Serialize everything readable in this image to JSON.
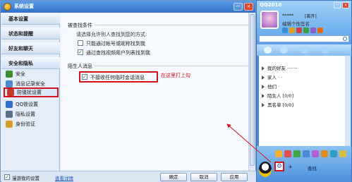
{
  "settings_window": {
    "title": "系统设置",
    "buttons": {
      "minimize": "－",
      "close": "×"
    },
    "sidebar": {
      "sections": [
        "基本设置",
        "状态和提醒",
        "好友和聊天",
        "安全和隐私"
      ],
      "items": [
        "安全",
        "消息记录安全",
        "防骚扰设置",
        "QQ锁设置",
        "隐私设置",
        "身份验证"
      ]
    },
    "content": {
      "section1_title": "被查找条件",
      "section1_caption": "请选择允许别人查找到您的方式:",
      "option1": "只能通过帐号或昵称找到我",
      "option2": "通过查找视频用户列表找到我",
      "section2_title": "陌生人消息",
      "option3": "不接收任何临时会话消息",
      "annotation": "在这里打上勾",
      "check_mark": "✓"
    },
    "footer": {
      "sync_label": "漫游我的设置",
      "sync_link": "查看详情",
      "ok": "确定",
      "cancel": "取消",
      "apply": "应用"
    }
  },
  "qq_panel": {
    "title": "QQ2010",
    "buttons": {
      "minimize": "－",
      "close": "×"
    },
    "nickname": "*****",
    "status": "[离开]",
    "signature": "编辑个性签名",
    "groups": [
      "我的好友",
      "家人",
      "他们",
      "陌生人 [0/0]",
      "黑名单 [0/0]"
    ],
    "group_suffixes": [
      " ·······",
      " · ·",
      " ·",
      "",
      ""
    ],
    "bottom_items": [
      "✈",
      "查找"
    ],
    "gear_glyph": "⚙"
  },
  "colors": {
    "accent_blue": "#2f72c9",
    "highlight_red": "#d1121b",
    "panel_blue": "#5e9ee6"
  }
}
